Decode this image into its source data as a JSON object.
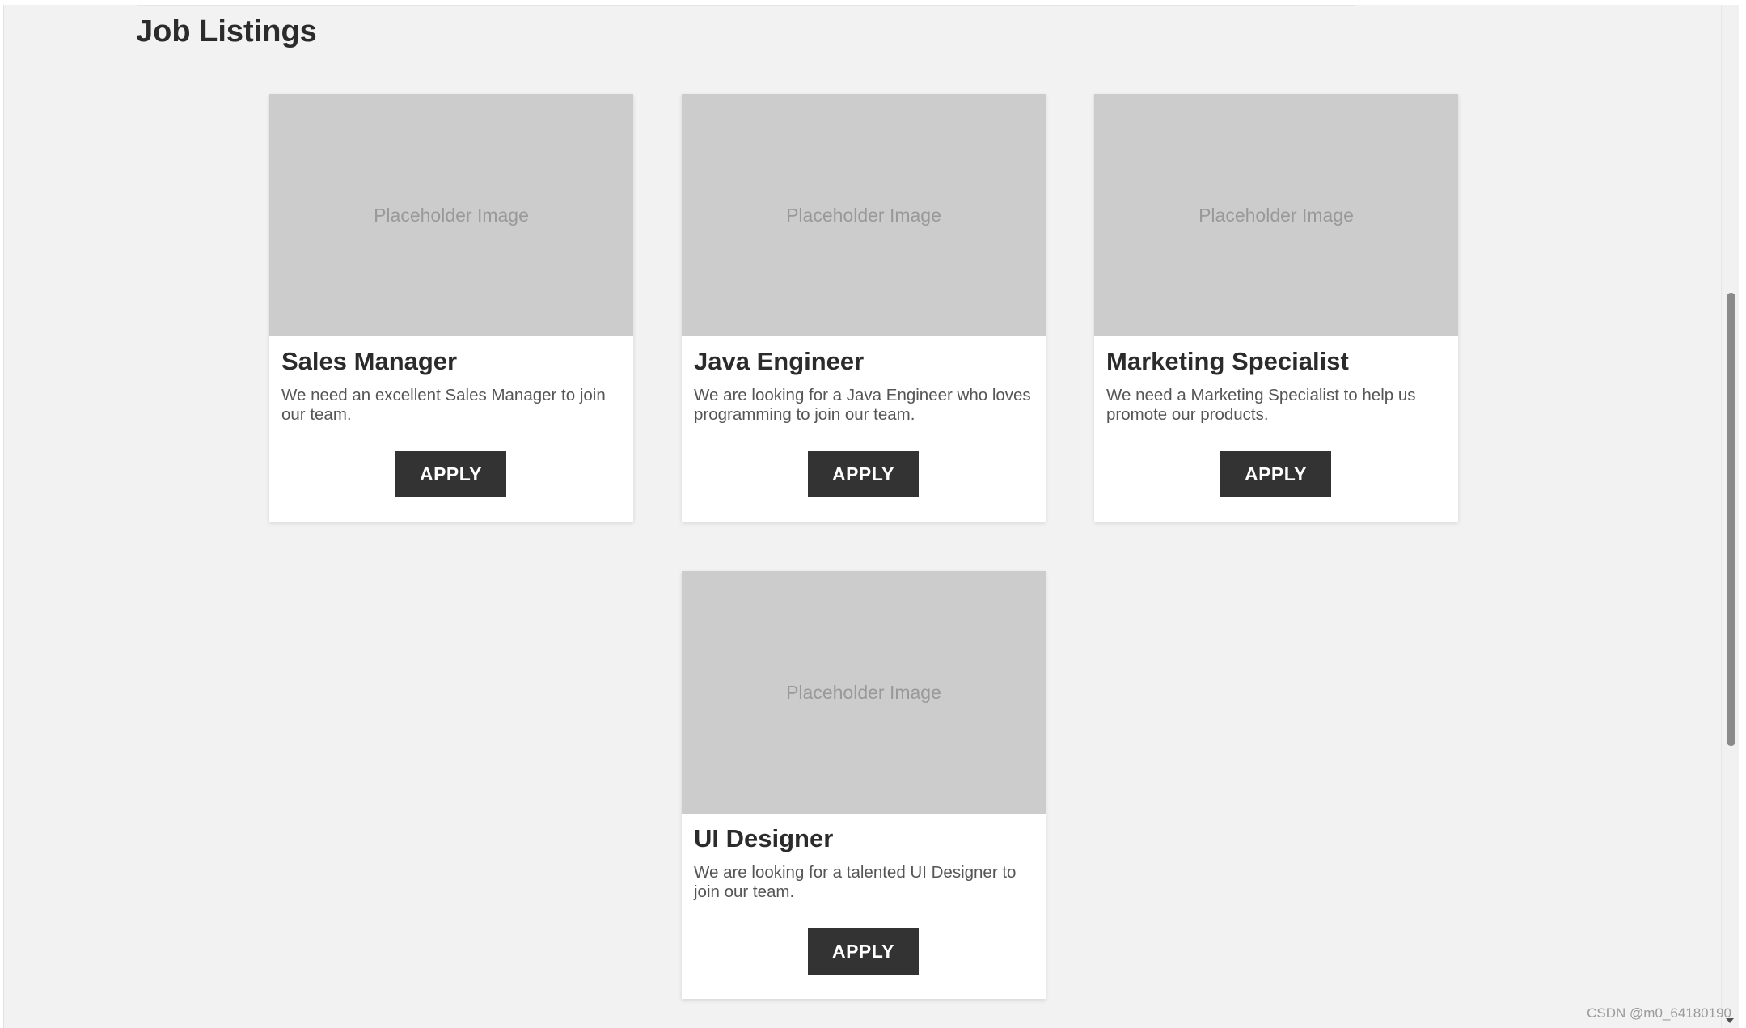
{
  "page": {
    "title": "Job Listings"
  },
  "jobs": [
    {
      "image_text": "Placeholder Image",
      "title": "Sales Manager",
      "description": "We need an excellent Sales Manager to join our team.",
      "button_label": "APPLY"
    },
    {
      "image_text": "Placeholder Image",
      "title": "Java Engineer",
      "description": "We are looking for a Java Engineer who loves programming to join our team.",
      "button_label": "APPLY"
    },
    {
      "image_text": "Placeholder Image",
      "title": "Marketing Specialist",
      "description": "We need a Marketing Specialist to help us promote our products.",
      "button_label": "APPLY"
    },
    {
      "image_text": "Placeholder Image",
      "title": "UI Designer",
      "description": "We are looking for a talented UI Designer to join our team.",
      "button_label": "APPLY"
    }
  ],
  "watermark": "CSDN @m0_64180190",
  "colors": {
    "background": "#f2f2f2",
    "card": "#ffffff",
    "placeholder": "#cccccc",
    "button": "#333333",
    "button_text": "#ffffff"
  }
}
